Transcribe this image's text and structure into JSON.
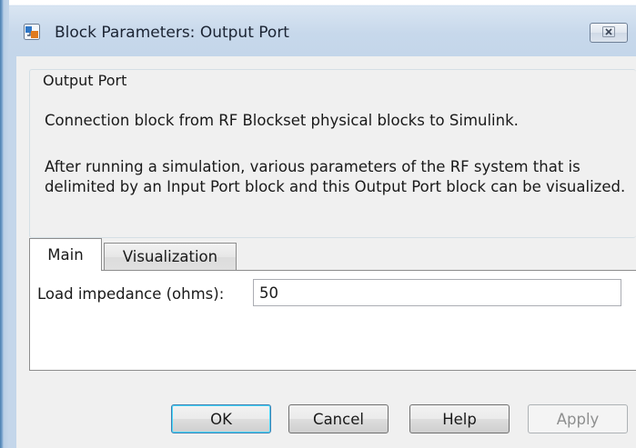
{
  "window": {
    "title": "Block Parameters: Output Port",
    "close_icon": "close-x-icon",
    "app_icon": "simulink-block-icon"
  },
  "group": {
    "legend": "Output Port",
    "description_1": "Connection block from RF Blockset physical blocks to Simulink.",
    "description_2": "After running a simulation, various parameters of the RF system that is delimited by an Input Port block and this Output Port block can be visualized."
  },
  "tabs": [
    {
      "label": "Main",
      "selected": true
    },
    {
      "label": "Visualization",
      "selected": false
    }
  ],
  "main": {
    "load_impedance_label": "Load impedance (ohms):",
    "load_impedance_value": "50"
  },
  "buttons": {
    "ok": "OK",
    "cancel": "Cancel",
    "help": "Help",
    "apply": "Apply"
  },
  "colors": {
    "frame": "#c4d6ea",
    "client_bg": "#f0f0f0",
    "ok_border": "#3c7fb1"
  }
}
